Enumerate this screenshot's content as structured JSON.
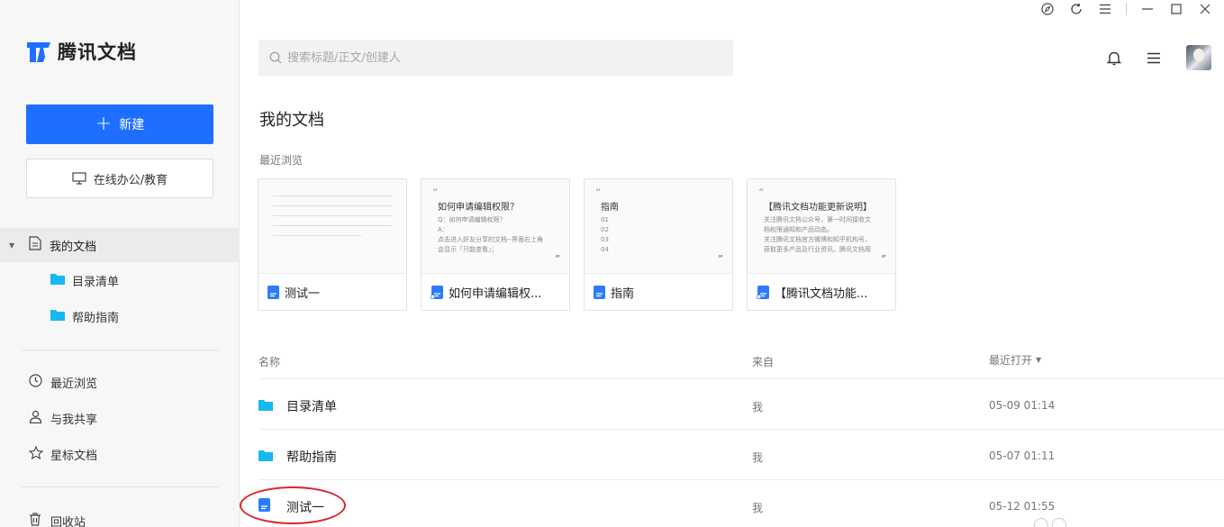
{
  "app": {
    "brand": "腾讯文档",
    "colors": {
      "accent": "#1e6fff",
      "folder": "#16b8f3",
      "doc": "#2b7bff",
      "highlight": "#d9262c"
    }
  },
  "window_controls": [
    "compass-icon",
    "refresh-icon",
    "menu-icon",
    "minimize-icon",
    "maximize-icon",
    "close-icon"
  ],
  "sidebar": {
    "new_button": "新建",
    "office_button": "在线办公/教育",
    "my_docs": "我的文档",
    "folders": [
      "目录清单",
      "帮助指南"
    ],
    "items": [
      {
        "label": "最近浏览",
        "icon": "clock-icon"
      },
      {
        "label": "与我共享",
        "icon": "person-icon"
      },
      {
        "label": "星标文档",
        "icon": "star-icon"
      },
      {
        "label": "回收站",
        "icon": "trash-icon"
      }
    ]
  },
  "search": {
    "placeholder": "搜索标题/正文/创建人"
  },
  "main": {
    "title": "我的文档",
    "recent_label": "最近浏览",
    "cards": [
      {
        "title": "测试一",
        "preview_title": "",
        "preview_body": ""
      },
      {
        "title": "如何申请编辑权...",
        "preview_title": "如何申请编辑权限？",
        "preview_body": "Q：如何申请编辑权限？\nA：\n点击进入好友分享的文档--界面右上角\n会显示「只能查看」；"
      },
      {
        "title": "指南",
        "preview_title": "指南",
        "preview_body": "01\n02\n03\n04"
      },
      {
        "title": "【腾讯文档功能...",
        "preview_title": "【腾讯文档功能更新说明】",
        "preview_body": "关注腾讯文档公众号，第一时间接收文\n档权限通知和产品动态。\n关注腾讯文档官方微博和知乎机构号，\n获取更多产品及行业资讯。腾讯文档用"
      }
    ],
    "table": {
      "headers": {
        "name": "名称",
        "from": "来自",
        "opened": "最近打开"
      },
      "rows": [
        {
          "type": "folder",
          "name": "目录清单",
          "from": "我",
          "time": "05-09 01:14"
        },
        {
          "type": "folder",
          "name": "帮助指南",
          "from": "我",
          "time": "05-07 01:11"
        },
        {
          "type": "doc",
          "name": "测试一",
          "from": "我",
          "time": "05-12 01:55"
        }
      ]
    }
  }
}
